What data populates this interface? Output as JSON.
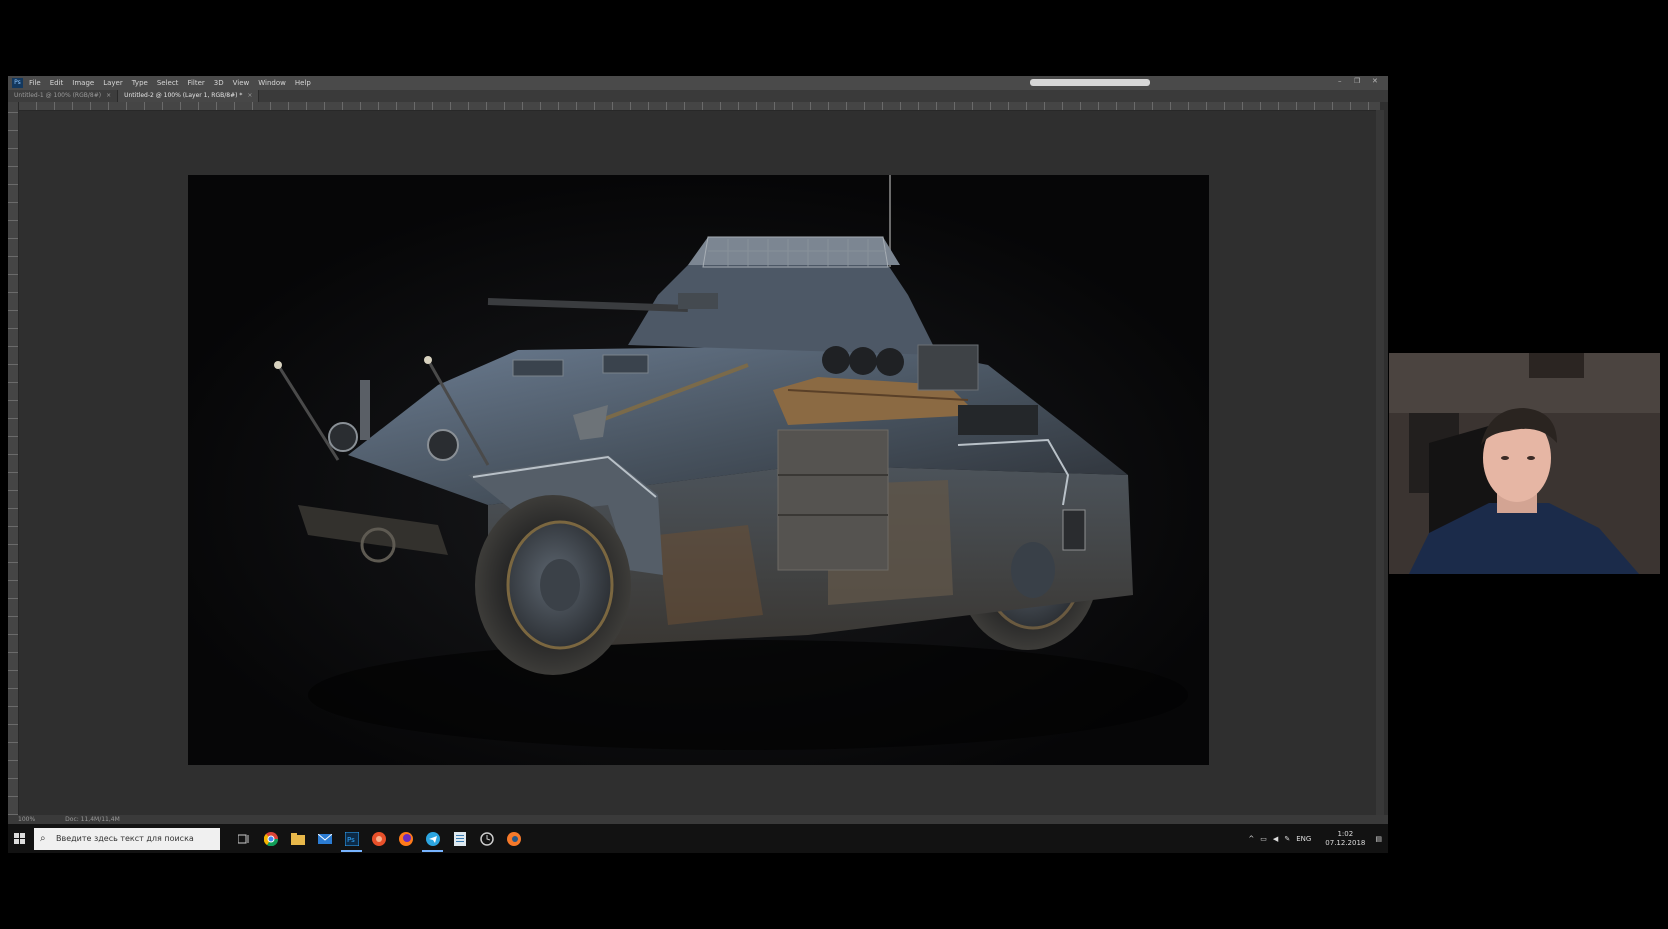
{
  "app": {
    "logo": "Ps",
    "menu": [
      "File",
      "Edit",
      "Image",
      "Layer",
      "Type",
      "Select",
      "Filter",
      "3D",
      "View",
      "Window",
      "Help"
    ]
  },
  "tabs": [
    {
      "label": "Untitled-1 @ 100% (RGB/8#)",
      "close": "×",
      "active": false
    },
    {
      "label": "Untitled-2 @ 100% (Layer 1, RGB/8#) *",
      "close": "×",
      "active": true
    }
  ],
  "window_controls": {
    "minimize": "–",
    "restore": "❐",
    "close": "✕"
  },
  "status": {
    "zoom": "100%",
    "doc": "Doc: 11,4M/11,4M"
  },
  "taskbar": {
    "search_placeholder": "Введите здесь текст для поиска",
    "apps": [
      "chrome-icon",
      "explorer-icon",
      "mail-icon",
      "photoshop-icon",
      "app-red-icon",
      "firefox-icon",
      "telegram-icon",
      "notepad-icon",
      "clock-app-icon",
      "blender-icon"
    ],
    "tray_lang": "ENG",
    "time": "1:02",
    "date": "07.12.2018"
  },
  "colors": {
    "workspace": "#2f2f2f",
    "menubar": "#4a4a4a",
    "canvas": "#0a0a0b",
    "taskbar": "#121212",
    "vehicle_steel": "#4e5a67",
    "accent": "#77b4ff"
  }
}
